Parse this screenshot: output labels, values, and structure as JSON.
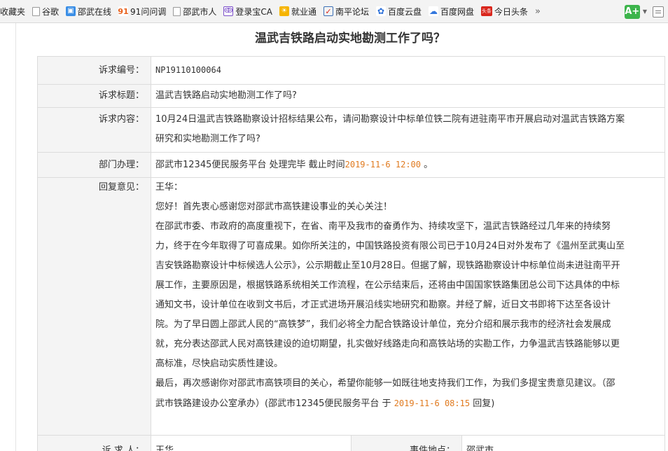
{
  "bookmarks": {
    "items": [
      {
        "label": "收藏夹",
        "icon": "none"
      },
      {
        "label": "谷歌",
        "icon": "page-icon"
      },
      {
        "label": "邵武在线",
        "icon": "blue-site-icon"
      },
      {
        "label": "91问问调",
        "icon": "91-icon"
      },
      {
        "label": "邵武市人",
        "icon": "page-icon"
      },
      {
        "label": "登录宝CA",
        "icon": "ca-icon"
      },
      {
        "label": "就业通",
        "icon": "sun-icon"
      },
      {
        "label": "南平论坛",
        "icon": "check-icon"
      },
      {
        "label": "百度云盘",
        "icon": "paw-icon"
      },
      {
        "label": "百度网盘",
        "icon": "cloud-icon"
      },
      {
        "label": "今日头条",
        "icon": "toutiao-icon"
      }
    ],
    "more": "»"
  },
  "page": {
    "title": "温武吉铁路启动实地勘测工作了吗？"
  },
  "detail": {
    "code_label": "诉求编号：",
    "code_value": "NP19110100064",
    "title_label": "诉求标题：",
    "title_value": "温武吉铁路启动实地勘测工作了吗?",
    "content_label": "诉求内容：",
    "content_line1": "10月24日温武吉铁路勘察设计招标结果公布，请问勘察设计中标单位铁二院有进驻南平市开展启动对温武吉铁路方案",
    "content_line2": "研究和实地勘测工作了吗?",
    "dept_label": "部门办理：",
    "dept_value": "邵武市12345便民服务平台 处理完毕 截止时间",
    "dept_deadline": "2019-11-6 12:00",
    "dept_end": " 。",
    "reply_label": "回复意见：",
    "reply_lines": [
      "王华：",
      "您好！首先衷心感谢您对邵武市高铁建设事业的关心关注！",
      "在邵武市委、市政府的高度重视下，在省、南平及我市的奋勇作为、持续攻坚下，温武吉铁路经过几年来的持续努",
      "力，终于在今年取得了可喜成果。如你所关注的，中国铁路投资有限公司已于10月24日对外发布了《温州至武夷山至",
      "吉安铁路勘察设计中标候选人公示》，公示期截止至10月28日。但据了解，现铁路勘察设计中标单位尚未进驻南平开",
      "展工作，主要原因是，根据铁路系统相关工作流程，在公示结束后，还将由中国国家铁路集团总公司下达具体的中标",
      "通知文书，设计单位在收到文书后，才正式进场开展沿线实地研究和勘察。并经了解，近日文书即将下达至各设计",
      "院。为了早日圆上邵武人民的“高铁梦”，我们必将全力配合铁路设计单位，充分介绍和展示我市的经济社会发展成",
      "就，充分表达邵武人民对高铁建设的迫切期望，扎实做好线路走向和高铁站场的实勘工作，力争温武吉铁路能够以更",
      "高标准，尽快启动实质性建设。",
      "最后，再次感谢你对邵武市高铁项目的关心，希望你能够一如既往地支持我们工作，为我们多提宝贵意见建议。（邵"
    ],
    "reply_last_prefix": "武市铁路建设办公室承办）(邵武市12345便民服务平台 于 ",
    "reply_time": "2019-11-6 08:15",
    "reply_last_suffix": " 回复)",
    "requester_label": "诉 求 人：",
    "requester_value": "王华",
    "location_label": "事件地点：",
    "location_value": "邵武市"
  },
  "colors": {
    "accent_orange": "#e07a1f",
    "label_bg": "#f4f4f4",
    "border": "#dcdcdc"
  }
}
